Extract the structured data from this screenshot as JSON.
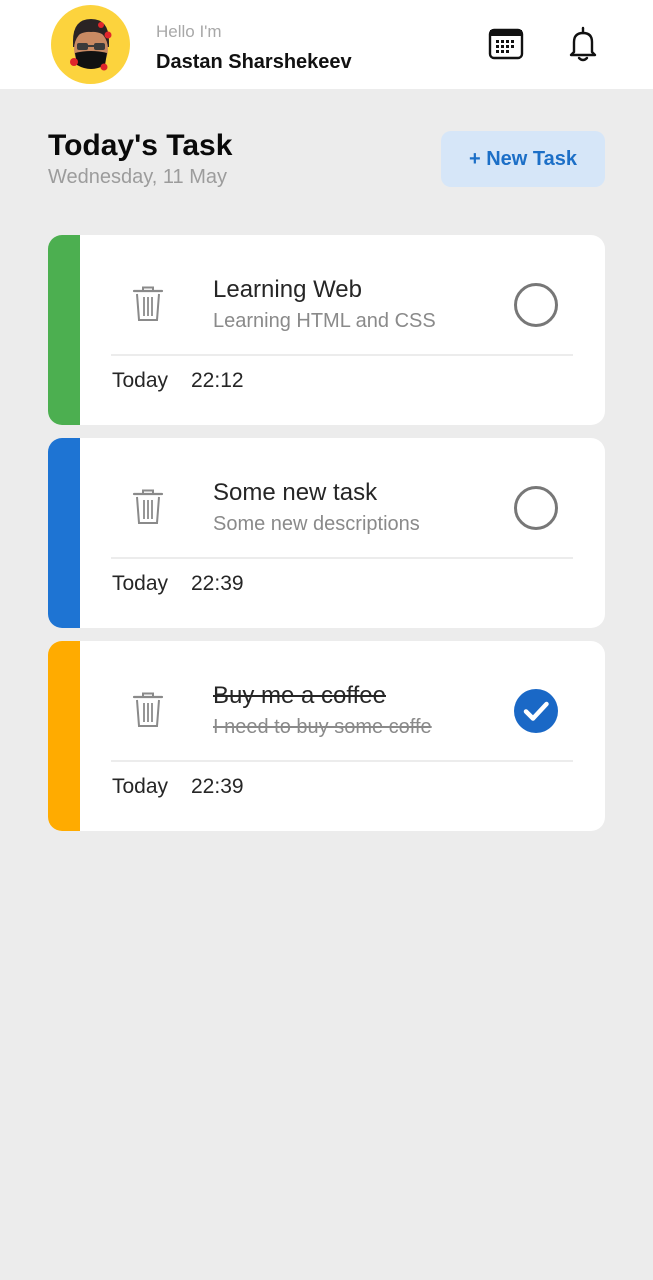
{
  "header": {
    "greeting": "Hello I'm",
    "user_name": "Dastan Sharshekeev",
    "avatar_icon": "memoji-avatar-icon",
    "calendar_icon": "calendar-icon",
    "bell_icon": "bell-icon"
  },
  "main": {
    "title": "Today's Task",
    "date": "Wednesday, 11 May",
    "new_task_label": "+ New Task"
  },
  "tasks": [
    {
      "title": "Learning Web",
      "description": "Learning HTML and CSS",
      "day": "Today",
      "time": "22:12",
      "color": "#4caf50",
      "completed": false
    },
    {
      "title": "Some new task",
      "description": "Some new descriptions",
      "day": "Today",
      "time": "22:39",
      "color": "#1e74d3",
      "completed": false
    },
    {
      "title": "Buy me a coffee",
      "description": "I need to buy some coffe",
      "day": "Today",
      "time": "22:39",
      "color": "#ffab00",
      "completed": true
    }
  ],
  "colors": {
    "accent": "#1a68c6",
    "avatar_bg": "#fcd33d",
    "page_bg": "#ececec"
  }
}
